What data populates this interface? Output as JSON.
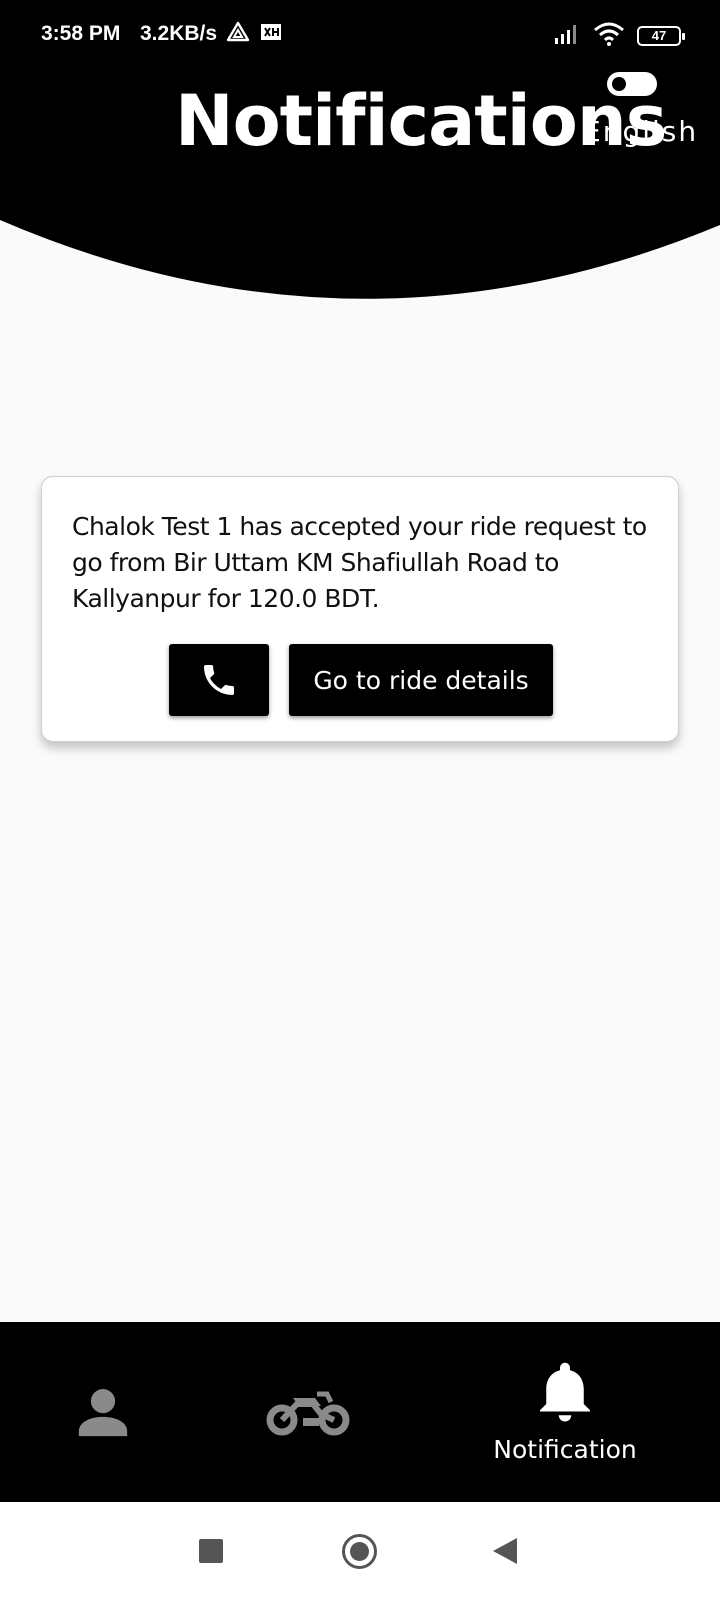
{
  "status_bar": {
    "time": "3:58 PM",
    "speed": "3.2KB/s",
    "battery": "47"
  },
  "header": {
    "title": "Notifications",
    "language_label": "English"
  },
  "notification_card": {
    "message": "Chalok Test 1 has accepted your ride request to go from Bir Uttam KM Shafiullah Road to Kallyanpur for 120.0 BDT.",
    "details_button_label": "Go to ride details"
  },
  "bottom_nav": {
    "active_label": "Notification"
  },
  "colors": {
    "header": "#000000",
    "background": "#fafafa",
    "inactive_icon": "#8a8a8a"
  }
}
